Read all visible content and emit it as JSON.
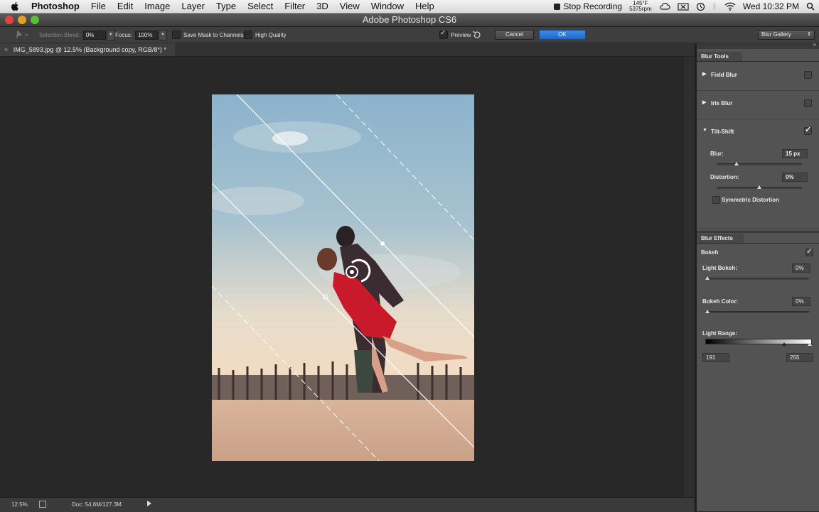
{
  "menubar": {
    "app": "Photoshop",
    "items": [
      "File",
      "Edit",
      "Image",
      "Layer",
      "Type",
      "Select",
      "Filter",
      "3D",
      "View",
      "Window",
      "Help"
    ],
    "stop_recording": "Stop Recording",
    "temp_line1": "145°F",
    "temp_line2": "5375rpm",
    "clock": "Wed 10:32 PM"
  },
  "window": {
    "title": "Adobe Photoshop CS6"
  },
  "options": {
    "selection_bleed_label": "Selection Bleed:",
    "selection_bleed_value": "0%",
    "focus_label": "Focus:",
    "focus_value": "100%",
    "save_mask_label": "Save Mask to Channels",
    "high_quality_label": "High Quality",
    "preview_label": "Preview",
    "cancel_label": "Cancel",
    "ok_label": "OK",
    "workspace": "Blur Gallery"
  },
  "document": {
    "tab_title": "IMG_5893.jpg @ 12.5% (Background copy, RGB/8*) *"
  },
  "status": {
    "zoom": "12.5%",
    "doc": "Doc: 54.6M/127.3M"
  },
  "blur_tools": {
    "header": "Blur Tools",
    "field_blur": "Field Blur",
    "iris_blur": "Iris Blur",
    "tilt_shift": "Tilt-Shift",
    "blur_label": "Blur:",
    "blur_value": "15 px",
    "distortion_label": "Distortion:",
    "distortion_value": "0%",
    "symmetric_label": "Symmetric Distortion"
  },
  "blur_effects": {
    "header": "Blur Effects",
    "bokeh": "Bokeh",
    "light_bokeh_label": "Light Bokeh:",
    "light_bokeh_value": "0%",
    "bokeh_color_label": "Bokeh Color:",
    "bokeh_color_value": "0%",
    "light_range_label": "Light Range:",
    "light_range_low": "191",
    "light_range_high": "255"
  }
}
